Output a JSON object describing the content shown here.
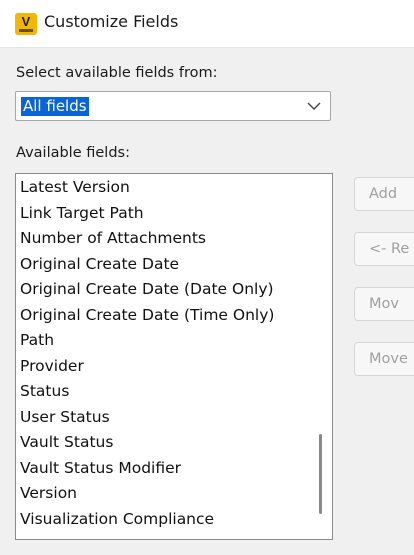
{
  "window": {
    "title": "Customize Fields",
    "icon": "vault-app-icon",
    "icon_letter": "V"
  },
  "source": {
    "label": "Select available fields from:",
    "selected": "All fields"
  },
  "available": {
    "label": "Available fields:",
    "items": [
      "Latest Version",
      "Link Target Path",
      "Number of Attachments",
      "Original Create Date",
      "Original Create Date (Date Only)",
      "Original Create Date (Time Only)",
      "Path",
      "Provider",
      "Status",
      "User Status",
      "Vault Status",
      "Vault Status Modifier",
      "Version",
      "Visualization Compliance"
    ]
  },
  "buttons": {
    "add": "Add",
    "remove": "<- Re",
    "move_up": "Mov",
    "move_down": "Move"
  },
  "colors": {
    "selection": "#0a64d6",
    "app_icon": "#f2b705"
  }
}
